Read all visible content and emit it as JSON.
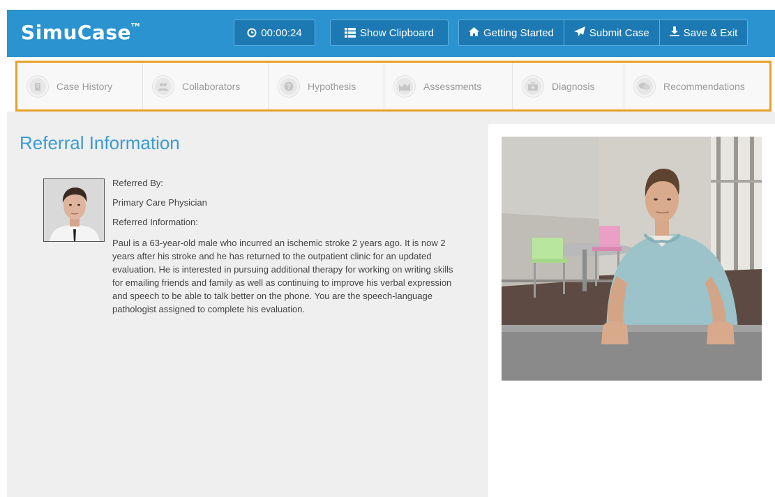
{
  "header": {
    "logo": "SimuCase",
    "logo_tm": "TM",
    "timer": "00:00:24",
    "show_clipboard": "Show Clipboard",
    "getting_started": "Getting Started",
    "submit_case": "Submit Case",
    "save_exit": "Save & Exit",
    "bg_color": "#2a93d0"
  },
  "steps": [
    {
      "label": "Case History",
      "icon": "building-icon"
    },
    {
      "label": "Collaborators",
      "icon": "people-icon"
    },
    {
      "label": "Hypothesis",
      "icon": "question-icon"
    },
    {
      "label": "Assessments",
      "icon": "chart-icon"
    },
    {
      "label": "Diagnosis",
      "icon": "medical-bag-icon"
    },
    {
      "label": "Recommendations",
      "icon": "speech-bubbles-icon"
    }
  ],
  "referral": {
    "title": "Referral Information",
    "referred_by_label": "Referred By:",
    "referred_by_value": "Primary Care Physician",
    "referred_info_label": "Referred Information:",
    "referred_info_text": "Paul is a 63-year-old male who incurred an ischemic stroke 2 years ago. It is now 2 years after his stroke and he has returned to the outpatient clinic for an updated evaluation. He is interested in pursuing additional therapy for working on writing skills for emailing friends and family as well as continuing to improve his verbal expression and speech to be able to talk better on the phone. You are the speech-language pathologist assigned to complete his evaluation."
  },
  "colors": {
    "accent": "#2a93d0",
    "highlight_border": "#e8a126",
    "title": "#3a9bd5"
  }
}
